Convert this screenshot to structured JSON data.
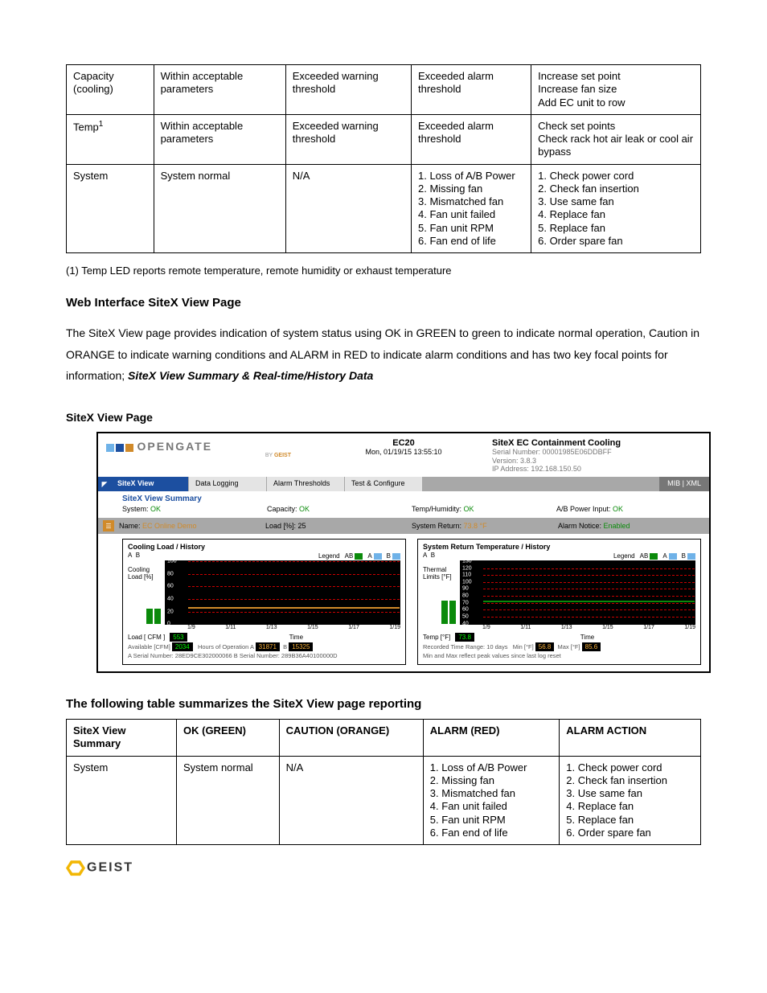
{
  "table1": {
    "rows": [
      {
        "c0": "Capacity (cooling)",
        "c1": "Within acceptable parameters",
        "c2": "Exceeded warning threshold",
        "c3": "Exceeded alarm threshold",
        "c4": "Increase set point\nIncrease fan size\nAdd EC unit to row"
      },
      {
        "c0": "Temp",
        "c0sup": "1",
        "c1": "Within acceptable parameters",
        "c2": "Exceeded warning threshold",
        "c3": "Exceeded alarm threshold",
        "c4": "Check set points\nCheck rack hot air leak or cool air bypass"
      },
      {
        "c0": "System",
        "c1": "System normal",
        "c2": "N/A",
        "c3": "1. Loss of A/B Power\n2. Missing fan\n3. Mismatched fan\n4. Fan unit failed\n5. Fan unit RPM\n6. Fan end of life",
        "c4": "1. Check power cord\n2. Check fan insertion\n3. Use same fan\n4. Replace fan\n5. Replace fan\n6. Order spare fan"
      }
    ]
  },
  "footnote": "(1) Temp LED reports remote temperature, remote humidity or exhaust temperature",
  "h_web": "Web Interface SiteX View Page",
  "para1a": "The SiteX View page provides indication of system status using OK in GREEN to green to indicate normal operation, Caution in ORANGE to indicate warning conditions and ALARM in RED to indicate alarm conditions and has two key focal points for information; ",
  "para1b": "SiteX View Summary & Real-time/History Data",
  "h_svp": "SiteX View Page",
  "shot": {
    "logo": "OPENGATE",
    "logo_by": "BY",
    "logo_geist": "GEIST",
    "mid_title": "EC20",
    "mid_time": "Mon, 01/19/15 13:55:10",
    "r_title": "SiteX EC Containment Cooling",
    "r_serial": "Serial Number: 00001985E06DDBFF",
    "r_ver": "Version: 3.8.3",
    "r_ip": "IP Address: 192.168.150.50",
    "tabs": [
      "SiteX View",
      "Data Logging",
      "Alarm Thresholds",
      "Test & Configure"
    ],
    "mibxml": "MIB  |  XML",
    "sum_title": "SiteX View Summary",
    "sum": [
      {
        "l": "System:",
        "v": "OK"
      },
      {
        "l": "Capacity:",
        "v": "OK"
      },
      {
        "l": "Temp/Humidity:",
        "v": "OK"
      },
      {
        "l": "A/B Power Input:",
        "v": "OK"
      }
    ],
    "row2": [
      {
        "l": "Name:",
        "v": "EC Online Demo",
        "cls": "orange"
      },
      {
        "l": "Load [%]:",
        "v": "25"
      },
      {
        "l": "System Return:",
        "v": "73.8 °F",
        "cls": "orange"
      },
      {
        "l": "Alarm Notice:",
        "v": "Enabled",
        "cls": "ok"
      }
    ],
    "chartL": {
      "title": "Cooling Load / History",
      "side": "Cooling Load [%]",
      "legend": [
        "AB",
        "A",
        "B"
      ],
      "below_l": "Load [ CFM ]",
      "below_v": "553",
      "xlabel": "Time",
      "line1": "Available [CFM]",
      "line1v": "2034",
      "line2": "Hours of Operation",
      "line2a": "31871",
      "line2b": "15325",
      "line3": "A Serial Number: 28ED9CE302000066    B Serial Number: 289B36A40100000D"
    },
    "chartR": {
      "title": "System Return Temperature / History",
      "side": "Thermal Limits [°F]",
      "legend": [
        "AB",
        "A",
        "B"
      ],
      "below_l": "Temp [°F]",
      "below_v": "73.8",
      "xlabel": "Time",
      "line1": "Recorded Time Range: 10 days",
      "min_l": "Min [°F]",
      "min_v": "56.8",
      "max_l": "Max [°F]",
      "max_v": "85.6",
      "line3": "Min and Max reflect peak values since last log reset"
    },
    "xticks": [
      "1/9",
      "1/11",
      "1/13",
      "1/15",
      "1/17",
      "1/19"
    ]
  },
  "h_table2": "The following table summarizes the SiteX View page reporting",
  "table2": {
    "head": [
      "SiteX View Summary",
      "OK (GREEN)",
      "CAUTION (ORANGE)",
      "ALARM (RED)",
      "ALARM ACTION"
    ],
    "rows": [
      {
        "c0": "System",
        "c1": "System normal",
        "c2": "N/A",
        "c3": "1. Loss of A/B Power\n2. Missing fan\n3. Mismatched fan\n4. Fan unit failed\n5. Fan unit RPM\n6. Fan end of life",
        "c4": "1. Check power cord\n2. Check fan insertion\n3. Use same fan\n4. Replace fan\n5. Replace fan\n6. Order spare fan"
      }
    ]
  },
  "footer_brand": "GEIST",
  "chart_data": [
    {
      "type": "bar",
      "title": "Cooling Load / History",
      "ylabel": "Cooling Load [%]",
      "xlabel": "Time",
      "ylim": [
        0,
        100
      ],
      "categories": [
        "1/9",
        "1/11",
        "1/13",
        "1/15",
        "1/17",
        "1/19"
      ],
      "series": [
        {
          "name": "A",
          "values": [
            25,
            25,
            25,
            25,
            25,
            25
          ]
        },
        {
          "name": "B",
          "values": [
            25,
            25,
            25,
            25,
            25,
            25
          ]
        }
      ],
      "current_cfm": 553,
      "available_cfm": 2034,
      "hours_A": 31871,
      "hours_B": 15325
    },
    {
      "type": "line",
      "title": "System Return Temperature / History",
      "ylabel": "Thermal Limits [°F]",
      "xlabel": "Time",
      "ylim": [
        40,
        130
      ],
      "x": [
        "1/9",
        "1/11",
        "1/13",
        "1/15",
        "1/17",
        "1/19"
      ],
      "series": [
        {
          "name": "AB",
          "values": [
            74,
            74,
            74,
            74,
            74,
            74
          ]
        }
      ],
      "current": 73.8,
      "min": 56.8,
      "max": 85.6,
      "range_days": 10
    }
  ]
}
